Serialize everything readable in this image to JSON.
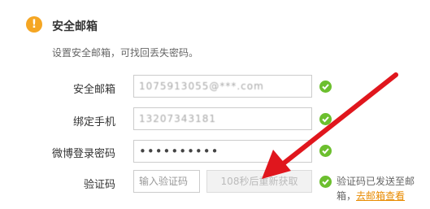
{
  "section": {
    "title": "安全邮箱",
    "description": "设置安全邮箱，可找回丢失密码。"
  },
  "form": {
    "email": {
      "label": "安全邮箱",
      "value": "1075913055@***.com"
    },
    "phone": {
      "label": "绑定手机",
      "value": "13207343181"
    },
    "password": {
      "label": "微博登录密码",
      "value": "••••••••••"
    },
    "code": {
      "label": "验证码",
      "placeholder": "输入验证码",
      "resend_label": "108秒后重新获取",
      "sent_prefix": "验证码已发送至邮箱，",
      "go_link": "去邮箱查看"
    }
  },
  "icons": {
    "warning": "exclamation-circle-icon",
    "check": "check-circle-icon"
  },
  "colors": {
    "warning": "#f5a623",
    "check": "#6cbf2e",
    "link": "#e88b00",
    "annotation_arrow": "#e0161d"
  }
}
